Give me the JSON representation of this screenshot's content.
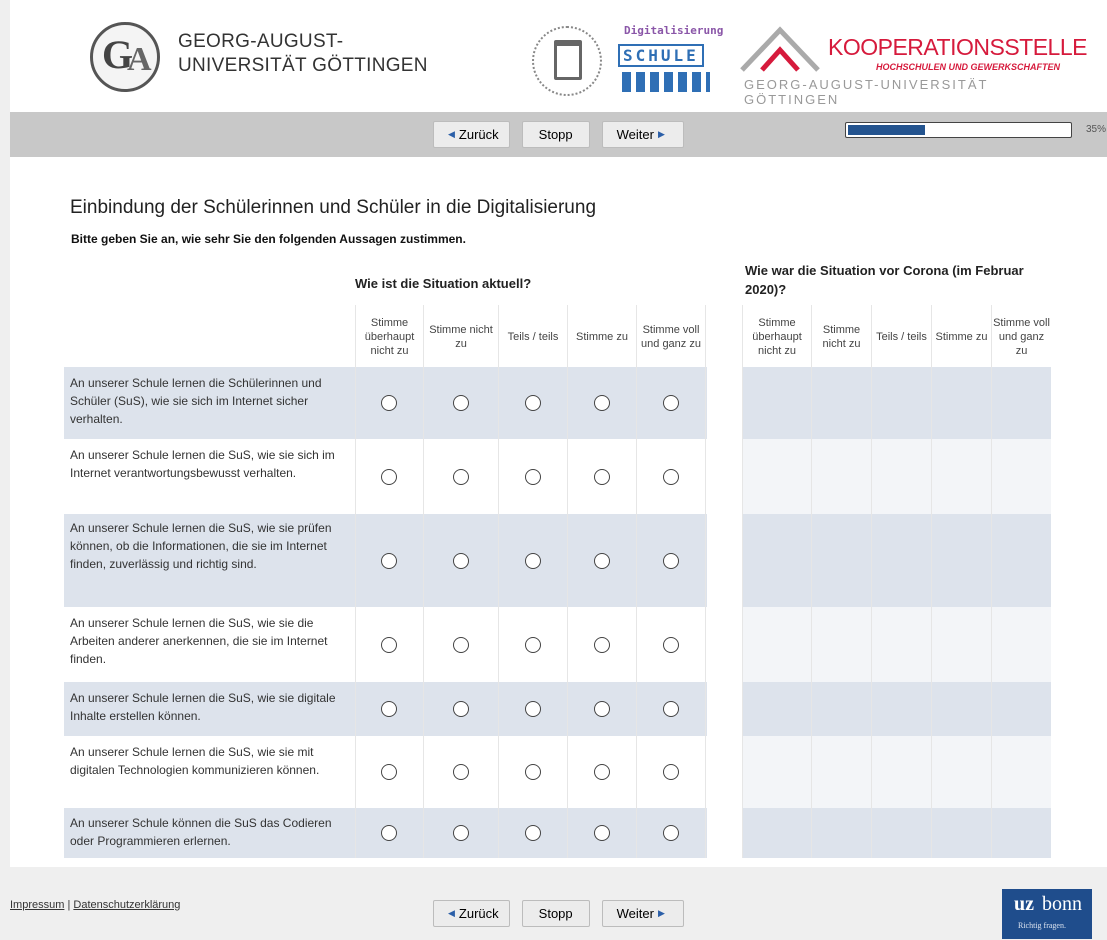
{
  "header": {
    "university": "GEORG-AUGUST-UNIVERSITÄT GÖTTINGEN",
    "digi_title": "Digitalisierung",
    "digi_word": "SCHULE",
    "koop_name": "KOOPERATIONSSTELLE",
    "koop_sub": "HOCHSCHULEN UND GEWERKSCHAFTEN",
    "koop_goe": "GEORG-AUGUST-UNIVERSITÄT GÖTTINGEN"
  },
  "nav": {
    "back": "Zurück",
    "stop": "Stopp",
    "next": "Weiter"
  },
  "progress": {
    "value": 0.35,
    "label": "35%"
  },
  "page_title": "Einbindung der Schülerinnen und Schüler in die Digitalisierung",
  "instruction": "Bitte geben Sie an, wie sehr Sie den folgenden Aussagen zustimmen.",
  "groups": {
    "now": "Wie ist die Situation aktuell?",
    "before": "Wie war die Situation vor Corona (im Februar 2020)?"
  },
  "scale": [
    "Stimme überhaupt nicht zu",
    "Stimme nicht zu",
    "Teils / teils",
    "Stimme zu",
    "Stimme voll und ganz zu"
  ],
  "items": [
    "An unserer Schule lernen die Schülerinnen und Schüler (SuS), wie sie sich im Internet sicher verhalten.",
    "An unserer Schule lernen die SuS, wie sie sich im Internet verantwortungsbewusst verhalten.",
    "An unserer Schule lernen die SuS, wie sie prüfen können, ob die Informationen, die sie im Internet finden, zuverlässig und richtig sind.",
    "An unserer Schule lernen die SuS, wie sie die Arbeiten anderer anerkennen, die sie im Internet finden.",
    "An unserer Schule lernen die SuS, wie sie digitale Inhalte erstellen können.",
    "An unserer Schule lernen die SuS, wie sie mit digitalen Technologien kommunizieren können.",
    "An unserer Schule können die SuS das Codieren oder Programmieren erlernen."
  ],
  "footer": {
    "impressum": "Impressum",
    "separator": " | ",
    "datenschutz": "Datenschutzerklärung"
  },
  "uzbonn": {
    "bold": "uz",
    "light": "bonn",
    "tag": "Richtig fragen."
  }
}
